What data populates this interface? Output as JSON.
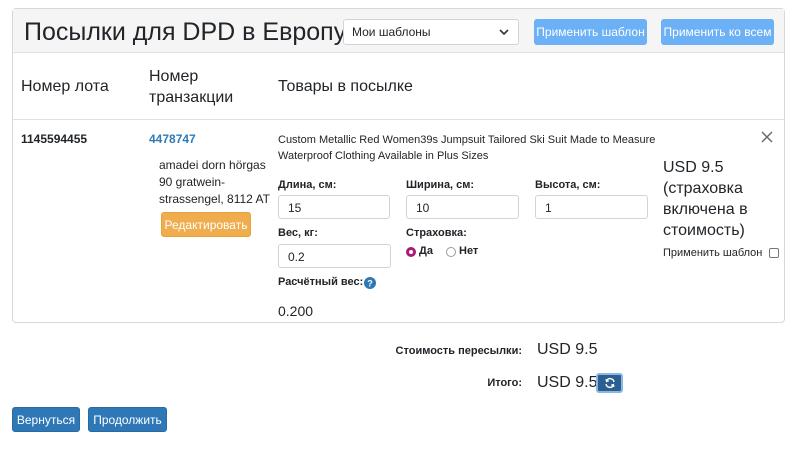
{
  "header": {
    "title": "Посылки для DPD в Европу",
    "template_select": "Мои шаблоны",
    "apply_template_button": "Применить шаблон",
    "apply_all_button": "Применить ко всем"
  },
  "columns": {
    "lot": "Номер лота",
    "transaction_line1": "Номер",
    "transaction_line2": "транзакции",
    "goods": "Товары в посылке"
  },
  "parcel": {
    "lot_number": "1145594455",
    "transaction_id": "4478747",
    "address": "amadei dorn hörgas 90 gratwein-strassengel, 8112 AT",
    "edit_button": "Редактировать",
    "item_title": "Custom Metallic Red Women39s Jumpsuit Tailored Ski Suit Made to Measure Waterproof Clothing Available in Plus Sizes",
    "length_label": "Длина, см:",
    "length_value": "15",
    "width_label": "Ширина, см:",
    "width_value": "10",
    "height_label": "Высота, см:",
    "height_value": "1",
    "weight_label": "Вес, кг:",
    "weight_value": "0.2",
    "insurance_label": "Страховка:",
    "insurance_yes": "Да",
    "insurance_no": "Нет",
    "insurance_selected": "Да",
    "calc_weight_label": "Расчётный вес:",
    "calc_weight_value": "0.200",
    "price_text": "USD 9.5 (страховка включена в стоимость)",
    "apply_template_label": "Применить шаблон",
    "apply_template_checked": false
  },
  "summary": {
    "shipping_label": "Стоимость пересылки:",
    "shipping_value": "USD 9.5",
    "total_label": "Итого:",
    "total_value": "USD 9.5"
  },
  "footer": {
    "back_button": "Вернуться",
    "continue_button": "Продолжить"
  },
  "colors": {
    "primary": "#2f78b7",
    "light_blue": "#6cb0f5",
    "warning": "#f0ad4e",
    "radio_accent": "#a51c7a",
    "link": "#2d7bb8"
  }
}
